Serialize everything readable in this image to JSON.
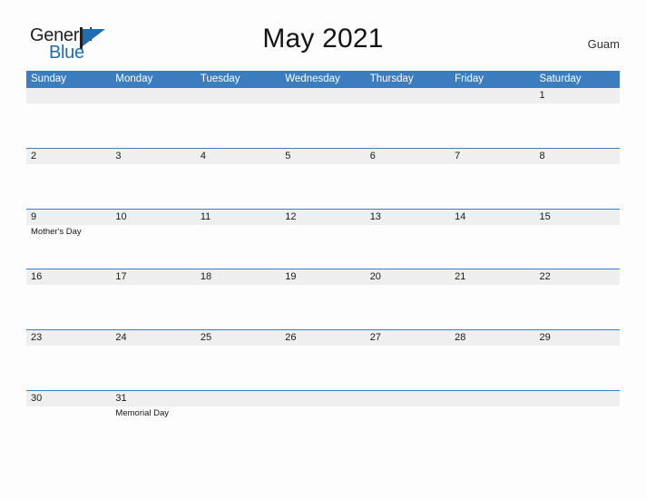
{
  "brand": {
    "name_part1": "General",
    "name_part2": "Blue",
    "mark": "triangle-flag-icon",
    "color_dark": "#231f20",
    "color_blue": "#1f6cb0"
  },
  "header": {
    "title": "May 2021",
    "locale": "Guam"
  },
  "colors": {
    "header_blue": "#3c7dbf",
    "number_band_gray": "#efefef",
    "rule_blue": "#3c7dbf",
    "page_background": "#fdfdfd",
    "text": "#1a1a1a"
  },
  "calendar": {
    "month": "May",
    "year": "2021",
    "weekdays": [
      "Sunday",
      "Monday",
      "Tuesday",
      "Wednesday",
      "Thursday",
      "Friday",
      "Saturday"
    ],
    "weeks": [
      {
        "days": [
          {
            "num": "",
            "event": ""
          },
          {
            "num": "",
            "event": ""
          },
          {
            "num": "",
            "event": ""
          },
          {
            "num": "",
            "event": ""
          },
          {
            "num": "",
            "event": ""
          },
          {
            "num": "",
            "event": ""
          },
          {
            "num": "1",
            "event": ""
          }
        ]
      },
      {
        "days": [
          {
            "num": "2",
            "event": ""
          },
          {
            "num": "3",
            "event": ""
          },
          {
            "num": "4",
            "event": ""
          },
          {
            "num": "5",
            "event": ""
          },
          {
            "num": "6",
            "event": ""
          },
          {
            "num": "7",
            "event": ""
          },
          {
            "num": "8",
            "event": ""
          }
        ]
      },
      {
        "days": [
          {
            "num": "9",
            "event": "Mother's Day"
          },
          {
            "num": "10",
            "event": ""
          },
          {
            "num": "11",
            "event": ""
          },
          {
            "num": "12",
            "event": ""
          },
          {
            "num": "13",
            "event": ""
          },
          {
            "num": "14",
            "event": ""
          },
          {
            "num": "15",
            "event": ""
          }
        ]
      },
      {
        "days": [
          {
            "num": "16",
            "event": ""
          },
          {
            "num": "17",
            "event": ""
          },
          {
            "num": "18",
            "event": ""
          },
          {
            "num": "19",
            "event": ""
          },
          {
            "num": "20",
            "event": ""
          },
          {
            "num": "21",
            "event": ""
          },
          {
            "num": "22",
            "event": ""
          }
        ]
      },
      {
        "days": [
          {
            "num": "23",
            "event": ""
          },
          {
            "num": "24",
            "event": ""
          },
          {
            "num": "25",
            "event": ""
          },
          {
            "num": "26",
            "event": ""
          },
          {
            "num": "27",
            "event": ""
          },
          {
            "num": "28",
            "event": ""
          },
          {
            "num": "29",
            "event": ""
          }
        ]
      },
      {
        "days": [
          {
            "num": "30",
            "event": ""
          },
          {
            "num": "31",
            "event": "Memorial Day"
          },
          {
            "num": "",
            "event": ""
          },
          {
            "num": "",
            "event": ""
          },
          {
            "num": "",
            "event": ""
          },
          {
            "num": "",
            "event": ""
          },
          {
            "num": "",
            "event": ""
          }
        ]
      }
    ]
  }
}
